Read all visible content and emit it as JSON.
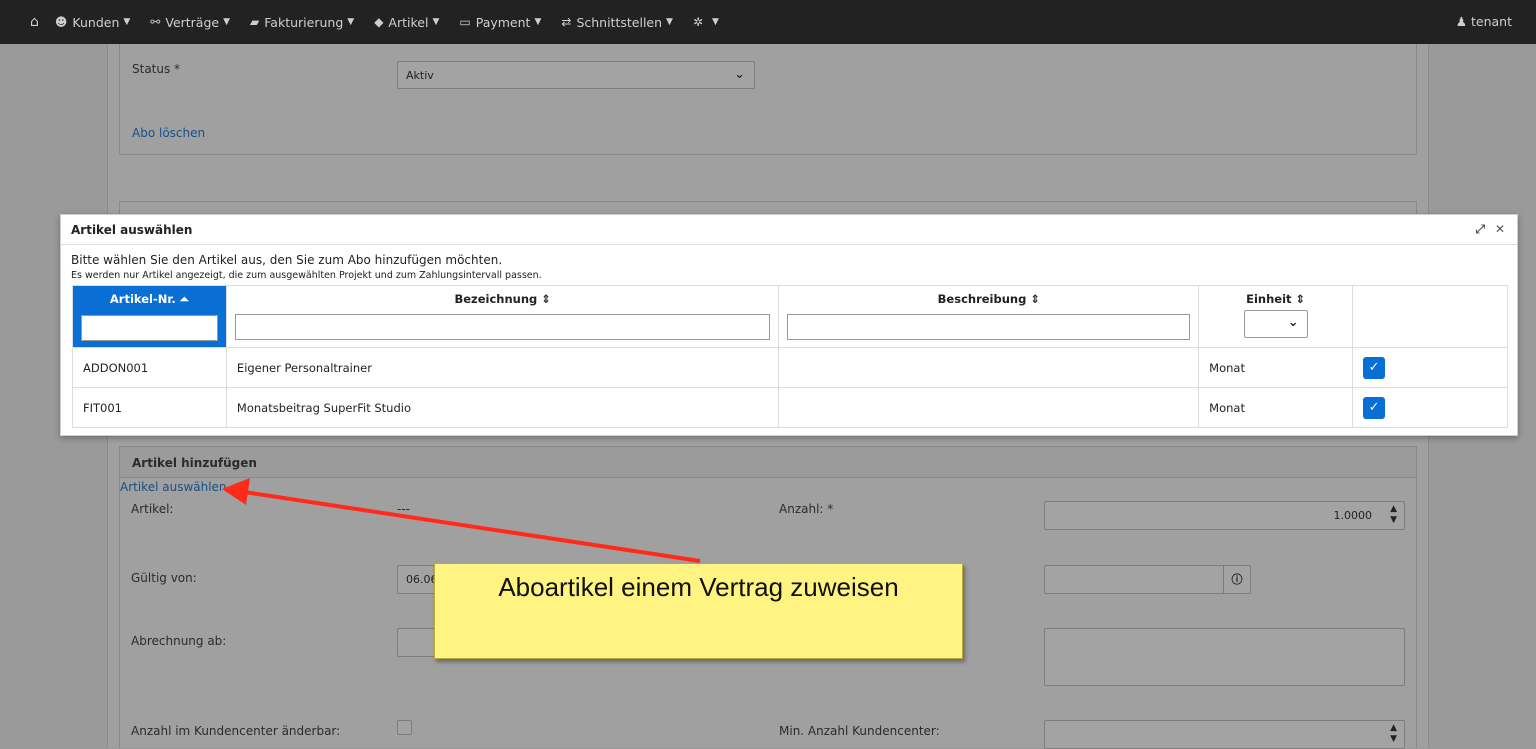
{
  "nav": {
    "items": [
      {
        "label": "Kunden",
        "icon": "users-icon"
      },
      {
        "label": "Verträge",
        "icon": "handshake-icon"
      },
      {
        "label": "Fakturierung",
        "icon": "book-icon"
      },
      {
        "label": "Artikel",
        "icon": "tag-icon"
      },
      {
        "label": "Payment",
        "icon": "credit-card-icon"
      },
      {
        "label": "Schnittstellen",
        "icon": "exchange-icon"
      }
    ],
    "user": "tenant"
  },
  "background": {
    "status_label": "Status *",
    "status_value": "Aktiv",
    "delete_link": "Abo löschen",
    "add_panel_title": "Artikel hinzufügen",
    "select_link": "Artikel auswählen",
    "artikel_label": "Artikel:",
    "artikel_value": "---",
    "anzahl_label": "Anzahl: *",
    "anzahl_value": "1.0000",
    "gueltig_label": "Gültig von:",
    "gueltig_value": "06.06.",
    "abrechnung_label": "Abrechnung ab:",
    "anzahl_kc_label": "Anzahl im Kundencenter änderbar:",
    "min_anzahl_label": "Min. Anzahl Kundencenter:"
  },
  "modal": {
    "title": "Artikel auswählen",
    "intro": "Bitte wählen Sie den Artikel aus, den Sie zum Abo hinzufügen möchten.",
    "note": "Es werden nur Artikel angezeigt, die zum ausgewählten Projekt und zum Zahlungsintervall passen.",
    "columns": [
      "Artikel-Nr. ⏶",
      "Bezeichnung ⇕",
      "Beschreibung ⇕",
      "Einheit ⇕"
    ],
    "rows": [
      {
        "nr": "ADDON001",
        "bezeichnung": "Eigener Personaltrainer",
        "beschreibung": "",
        "einheit": "Monat"
      },
      {
        "nr": "FIT001",
        "bezeichnung": "Monatsbeitrag SuperFit Studio",
        "beschreibung": "",
        "einheit": "Monat"
      }
    ]
  },
  "annotation": {
    "text": "Aboartikel einem Vertrag zuweisen",
    "color": "#ff2a1a"
  }
}
